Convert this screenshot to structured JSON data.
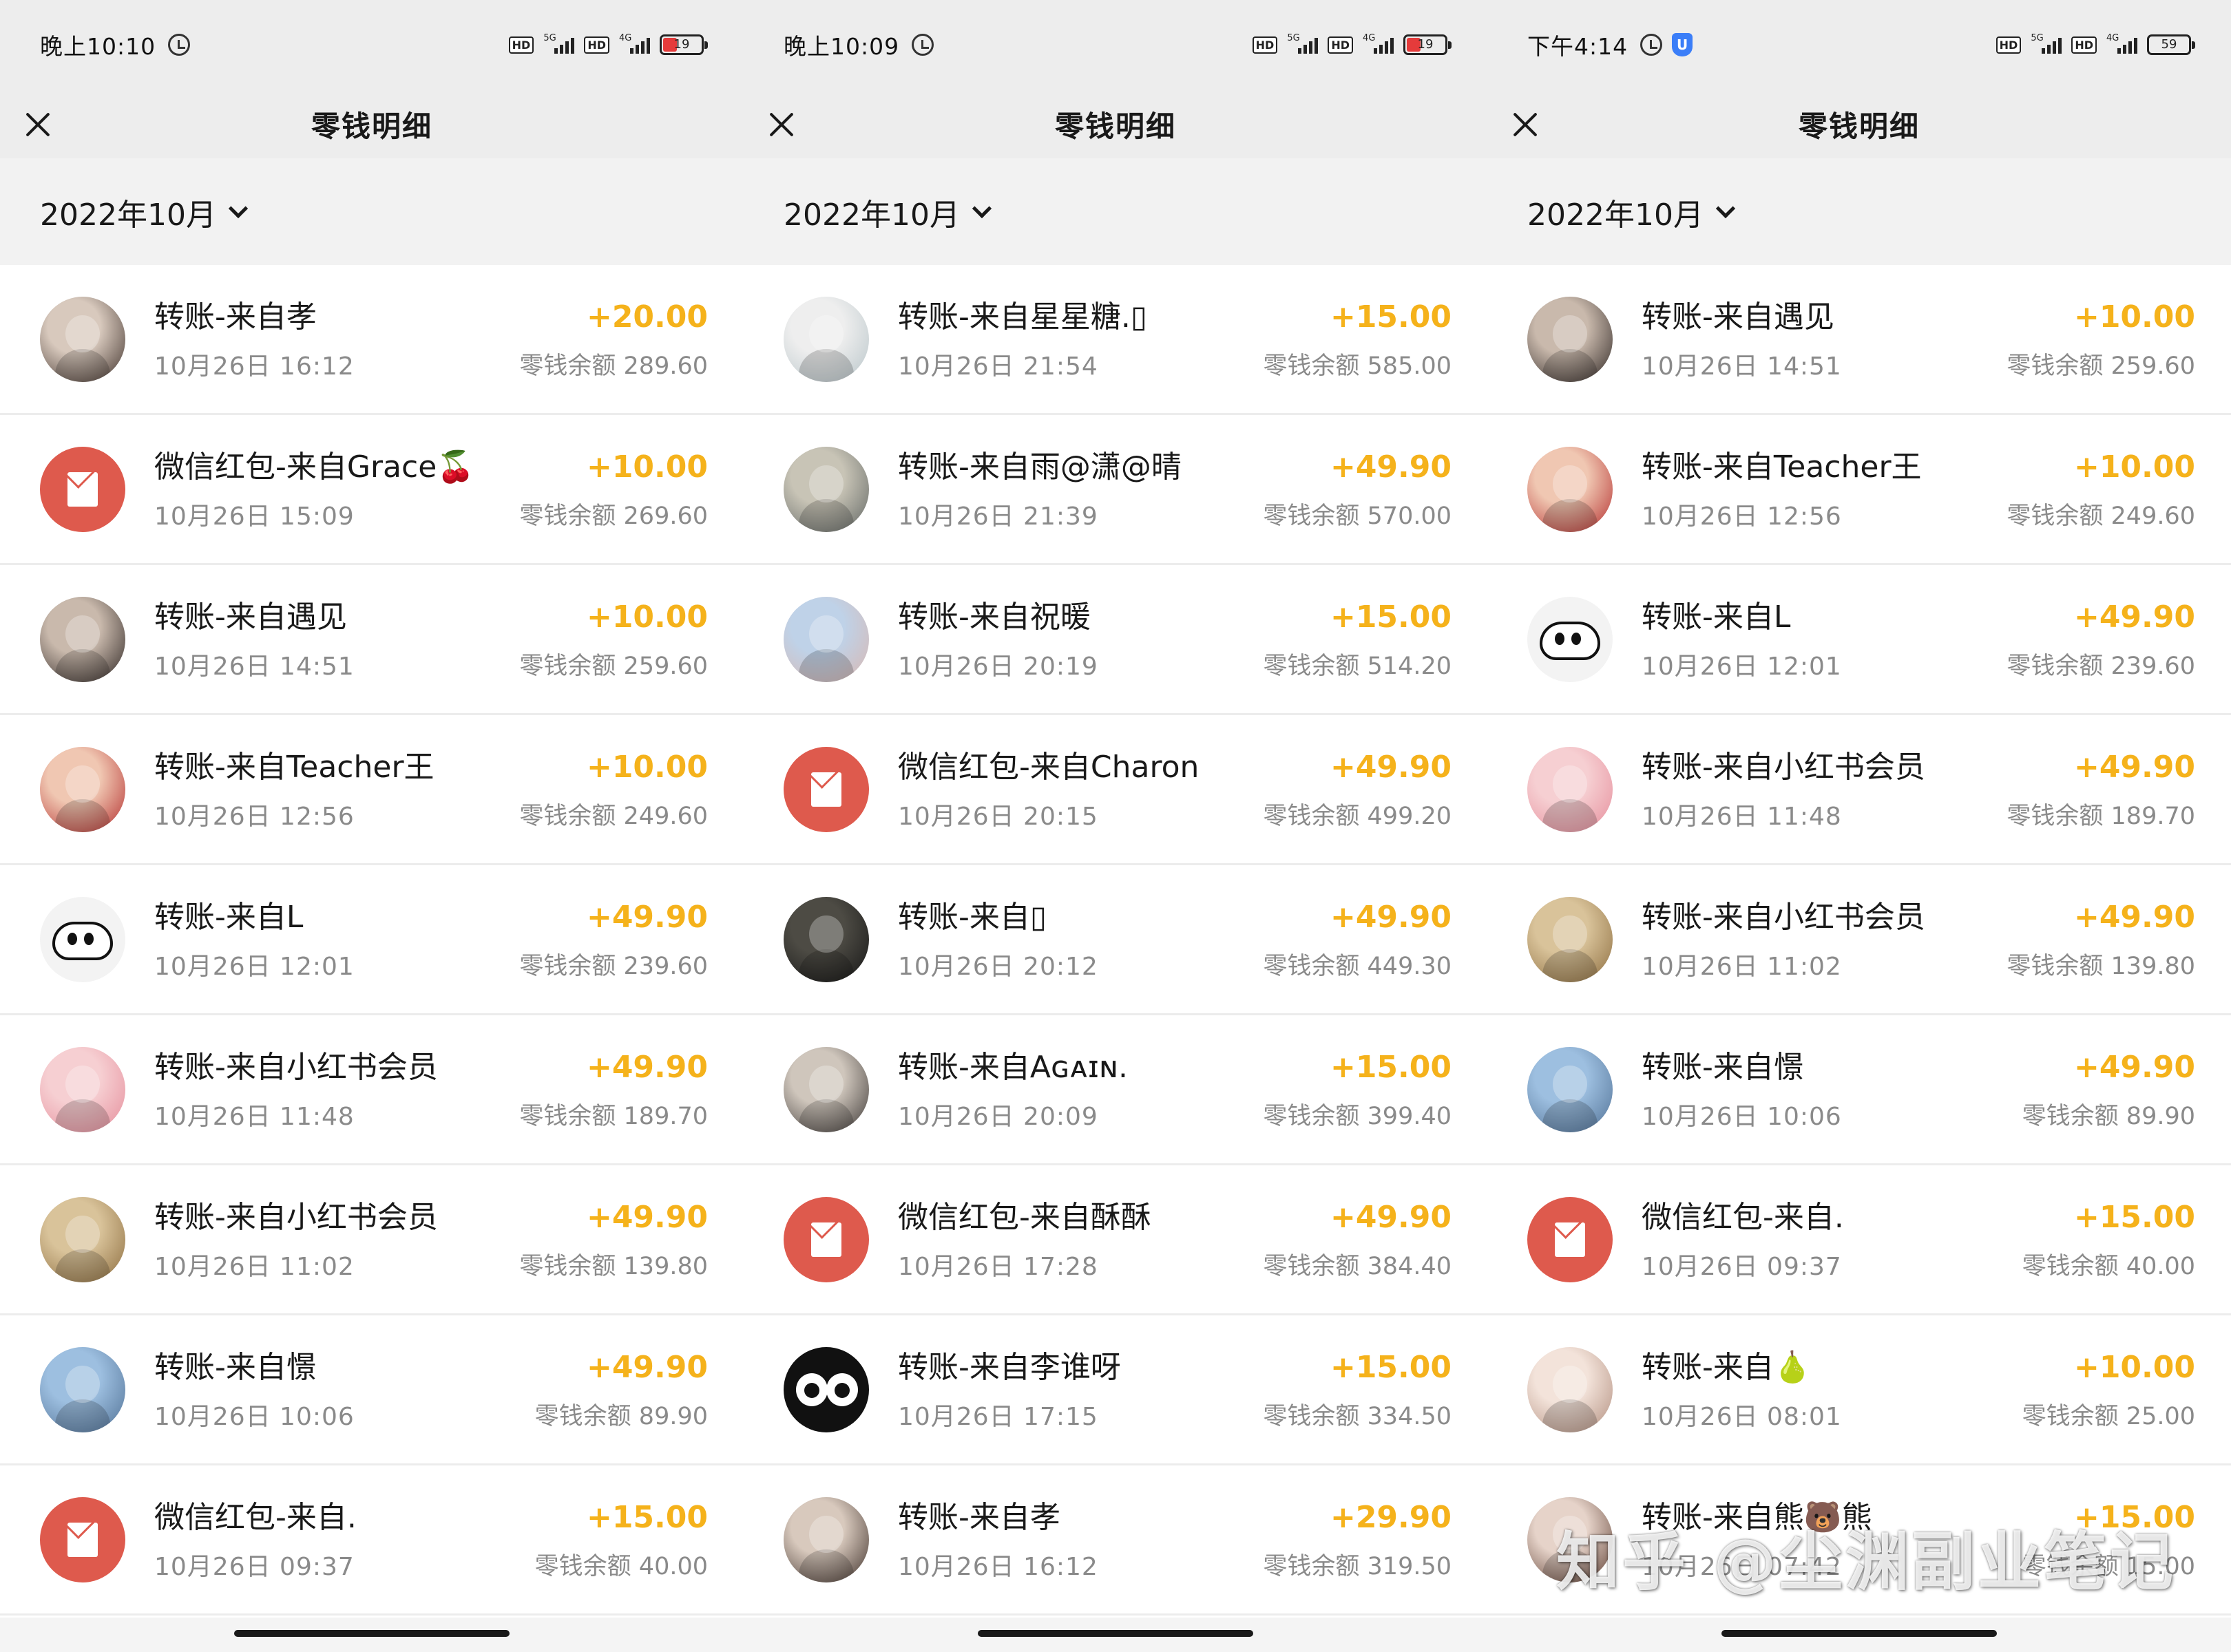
{
  "panels": [
    {
      "status": {
        "time": "晚上10:10",
        "battery": "19",
        "battery_low": true,
        "show_shield": false,
        "net1": "5G",
        "net2": "4G"
      },
      "nav": {
        "title": "零钱明细"
      },
      "month": "2022年10月",
      "rows": [
        {
          "title": "转账-来自孝",
          "time": "10月26日 16:12",
          "amount": "+20.00",
          "balance": "零钱余额 289.60",
          "avatar": "photo",
          "colors": [
            "#d8c9bd",
            "#3c2e28"
          ]
        },
        {
          "title": "微信红包-来自Grace🍒",
          "time": "10月26日 15:09",
          "amount": "+10.00",
          "balance": "零钱余额 269.60",
          "avatar": "redpacket"
        },
        {
          "title": "转账-来自遇见",
          "time": "10月26日 14:51",
          "amount": "+10.00",
          "balance": "零钱余额 259.60",
          "avatar": "photo",
          "colors": [
            "#c9b9ac",
            "#2a2220"
          ]
        },
        {
          "title": "转账-来自Teacher王",
          "time": "10月26日 12:56",
          "amount": "+10.00",
          "balance": "零钱余额 249.60",
          "avatar": "photo",
          "colors": [
            "#f0c7b2",
            "#b22a2a"
          ]
        },
        {
          "title": "转账-来自L",
          "time": "10月26日 12:01",
          "amount": "+49.90",
          "balance": "零钱余额 239.60",
          "avatar": "cartoon"
        },
        {
          "title": "转账-来自小红书会员",
          "time": "10月26日 11:48",
          "amount": "+49.90",
          "balance": "零钱余额 189.70",
          "avatar": "photo",
          "colors": [
            "#f6cfd2",
            "#e58c9a"
          ]
        },
        {
          "title": "转账-来自小红书会员",
          "time": "10月26日 11:02",
          "amount": "+49.90",
          "balance": "零钱余额 139.80",
          "avatar": "photo",
          "colors": [
            "#d9c39a",
            "#8a6a3c"
          ]
        },
        {
          "title": "转账-来自憬",
          "time": "10月26日 10:06",
          "amount": "+49.90",
          "balance": "零钱余额 89.90",
          "avatar": "photo",
          "colors": [
            "#9dbfe0",
            "#4f6f93"
          ]
        },
        {
          "title": "微信红包-来自.",
          "time": "10月26日 09:37",
          "amount": "+15.00",
          "balance": "零钱余额 40.00",
          "avatar": "redpacket"
        }
      ]
    },
    {
      "status": {
        "time": "晚上10:09",
        "battery": "19",
        "battery_low": true,
        "show_shield": false,
        "net1": "5G",
        "net2": "4G"
      },
      "nav": {
        "title": "零钱明细"
      },
      "month": "2022年10月",
      "rows": [
        {
          "title": "转账-来自星星糖.▯",
          "time": "10月26日 21:54",
          "amount": "+15.00",
          "balance": "零钱余额 585.00",
          "avatar": "photo",
          "colors": [
            "#eeeeee",
            "#b7c4c8"
          ]
        },
        {
          "title": "转账-来自雨@潇@晴",
          "time": "10月26日 21:39",
          "amount": "+49.90",
          "balance": "零钱余额 570.00",
          "avatar": "photo",
          "colors": [
            "#c8c4b6",
            "#5f6462"
          ]
        },
        {
          "title": "转账-来自祝暖",
          "time": "10月26日 20:19",
          "amount": "+15.00",
          "balance": "零钱余额 514.20",
          "avatar": "photo",
          "colors": [
            "#bfd2e8",
            "#d9b7b0"
          ]
        },
        {
          "title": "微信红包-来自Charon",
          "time": "10月26日 20:15",
          "amount": "+49.90",
          "balance": "零钱余额 499.20",
          "avatar": "redpacket"
        },
        {
          "title": "转账-来自▯",
          "time": "10月26日 20:12",
          "amount": "+49.90",
          "balance": "零钱余额 449.30",
          "avatar": "photo",
          "colors": [
            "#4d4b44",
            "#151515"
          ]
        },
        {
          "title": "转账-来自Aɢᴀɪɴ.",
          "time": "10月26日 20:09",
          "amount": "+15.00",
          "balance": "零钱余额 399.40",
          "avatar": "photo",
          "colors": [
            "#cfc6bc",
            "#3a3533"
          ]
        },
        {
          "title": "微信红包-来自酥酥",
          "time": "10月26日 17:28",
          "amount": "+49.90",
          "balance": "零钱余额 384.40",
          "avatar": "redpacket"
        },
        {
          "title": "转账-来自李谁呀",
          "time": "10月26日 17:15",
          "amount": "+15.00",
          "balance": "零钱余额 334.50",
          "avatar": "eyes"
        },
        {
          "title": "转账-来自孝",
          "time": "10月26日 16:12",
          "amount": "+29.90",
          "balance": "零钱余额 319.50",
          "avatar": "photo",
          "colors": [
            "#d8c9bd",
            "#3c2e28"
          ]
        }
      ]
    },
    {
      "status": {
        "time": "下午4:14",
        "battery": "59",
        "battery_low": false,
        "show_shield": true,
        "net1": "5G",
        "net2": "4G"
      },
      "nav": {
        "title": "零钱明细"
      },
      "month": "2022年10月",
      "rows": [
        {
          "title": "转账-来自遇见",
          "time": "10月26日 14:51",
          "amount": "+10.00",
          "balance": "零钱余额 259.60",
          "avatar": "photo",
          "colors": [
            "#c9b9ac",
            "#2a2220"
          ]
        },
        {
          "title": "转账-来自Teacher王",
          "time": "10月26日 12:56",
          "amount": "+10.00",
          "balance": "零钱余额 249.60",
          "avatar": "photo",
          "colors": [
            "#f0c7b2",
            "#b22a2a"
          ]
        },
        {
          "title": "转账-来自L",
          "time": "10月26日 12:01",
          "amount": "+49.90",
          "balance": "零钱余额 239.60",
          "avatar": "cartoon"
        },
        {
          "title": "转账-来自小红书会员",
          "time": "10月26日 11:48",
          "amount": "+49.90",
          "balance": "零钱余额 189.70",
          "avatar": "photo",
          "colors": [
            "#f6cfd2",
            "#e58c9a"
          ]
        },
        {
          "title": "转账-来自小红书会员",
          "time": "10月26日 11:02",
          "amount": "+49.90",
          "balance": "零钱余额 139.80",
          "avatar": "photo",
          "colors": [
            "#d9c39a",
            "#8a6a3c"
          ]
        },
        {
          "title": "转账-来自憬",
          "time": "10月26日 10:06",
          "amount": "+49.90",
          "balance": "零钱余额 89.90",
          "avatar": "photo",
          "colors": [
            "#9dbfe0",
            "#4f6f93"
          ]
        },
        {
          "title": "微信红包-来自.",
          "time": "10月26日 09:37",
          "amount": "+15.00",
          "balance": "零钱余额 40.00",
          "avatar": "redpacket"
        },
        {
          "title": "转账-来自🍐",
          "time": "10月26日 08:01",
          "amount": "+10.00",
          "balance": "零钱余额 25.00",
          "avatar": "photo",
          "colors": [
            "#f3e3da",
            "#b08c7c"
          ]
        },
        {
          "title": "转账-来自熊🐻熊",
          "time": "10月26日 07:42",
          "amount": "+15.00",
          "balance": "零钱余额 15.00",
          "avatar": "photo",
          "colors": [
            "#e6d3c9",
            "#5a3a2e"
          ]
        }
      ]
    }
  ],
  "watermark": "知乎 @尘渊副业笔记",
  "theme": {
    "accent_amount": "#f5b21b",
    "redpacket": "#de5a4d",
    "header_bg": "#ededed"
  }
}
